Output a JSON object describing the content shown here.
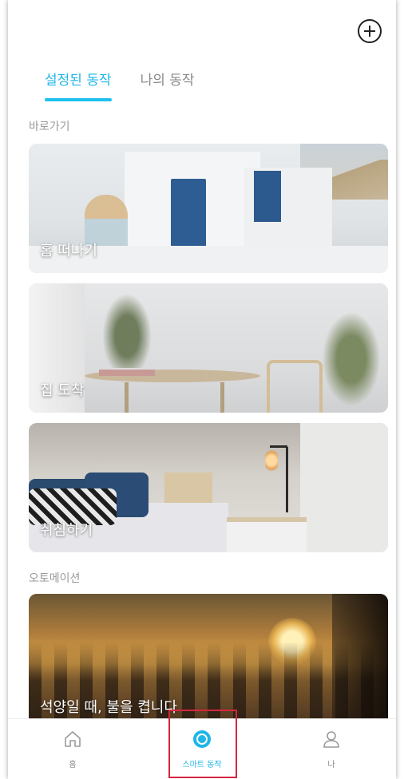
{
  "header": {
    "add_icon": "plus-circle-icon"
  },
  "tabs": [
    {
      "label": "설정된 동작",
      "active": true
    },
    {
      "label": "나의 동작",
      "active": false
    }
  ],
  "sections": {
    "shortcuts_label": "바로가기",
    "automation_label": "오토메이션"
  },
  "cards": [
    {
      "label": "홈 떠나기",
      "image": "white-greek-house-with-blue-doors"
    },
    {
      "label": "집 도착",
      "image": "dining-room-with-plants"
    },
    {
      "label": "취침하기",
      "image": "bedroom-with-lamp"
    },
    {
      "label": "석양일 때, 불을 켭니다",
      "image": "sunset-forest"
    }
  ],
  "bottom_nav": [
    {
      "label": "홈",
      "icon": "home-icon",
      "active": false
    },
    {
      "label": "스마트 동작",
      "icon": "smart-action-icon",
      "active": true
    },
    {
      "label": "나",
      "icon": "person-icon",
      "active": false
    }
  ],
  "colors": {
    "accent": "#1FB6E8",
    "highlight_box": "#D7263D"
  }
}
